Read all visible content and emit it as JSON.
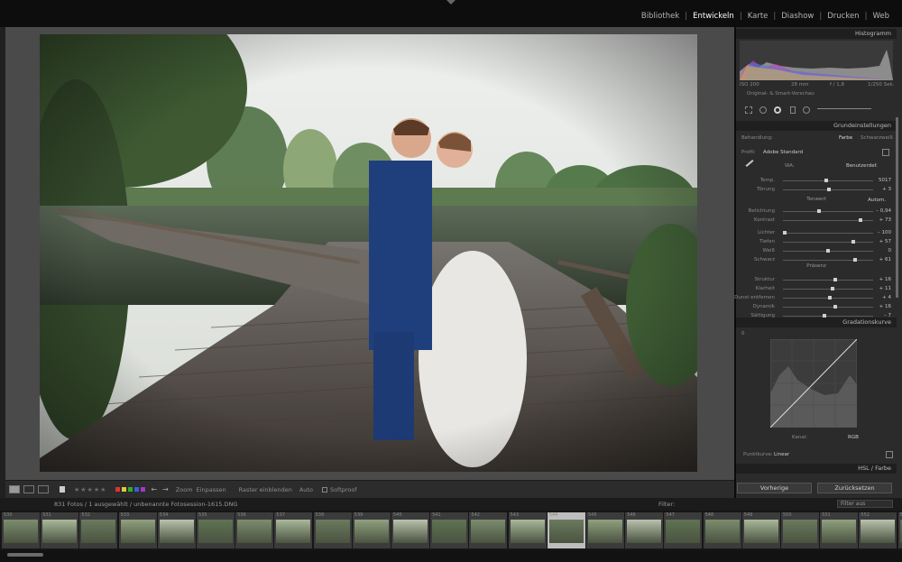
{
  "modules": [
    "Bibliothek",
    "Entwickeln",
    "Karte",
    "Diashow",
    "Drucken",
    "Web"
  ],
  "active_module": "Entwickeln",
  "toolbar": {
    "zoom_label": "Zoom",
    "zoom_value": "Einpassen",
    "raster_label": "Raster einblenden",
    "raster_value": "Auto",
    "softproof": "Softproof"
  },
  "panel": {
    "histogram": {
      "title": "Histogramm",
      "iso": "ISO 200",
      "focal": "28 mm",
      "aperture": "f / 1,8",
      "shutter": "1/250 Sek.",
      "preview_label": "Original- & Smart-Vorschau"
    },
    "basic": {
      "title": "Grundeinstellungen",
      "treatment_label": "Behandlung:",
      "treatment_color": "Farbe",
      "treatment_bw": "Schwarzweiß",
      "profile_label": "Profil:",
      "profile_value": "Adobe Standard",
      "wb_label": "WA:",
      "wb_value": "Benutzerdef.",
      "sliders": [
        {
          "label": "Temp.",
          "value": "5017",
          "pos": 0.48
        },
        {
          "label": "Tönung",
          "value": "+ 3",
          "pos": 0.51
        },
        {
          "label": "Belichtung",
          "value": "– 0,94",
          "pos": 0.4
        },
        {
          "label": "Kontrast",
          "value": "+ 73",
          "pos": 0.86
        },
        {
          "label": "Lichter",
          "value": "– 100",
          "pos": 0.02
        },
        {
          "label": "Tiefen",
          "value": "+ 57",
          "pos": 0.78
        },
        {
          "label": "Weiß",
          "value": "0",
          "pos": 0.5
        },
        {
          "label": "Schwarz",
          "value": "+ 61",
          "pos": 0.8
        },
        {
          "label": "Struktur",
          "value": "+ 16",
          "pos": 0.58
        },
        {
          "label": "Klarheit",
          "value": "+ 11",
          "pos": 0.55
        },
        {
          "label": "Dunst entfernen",
          "value": "+ 4",
          "pos": 0.52
        },
        {
          "label": "Dynamik",
          "value": "+ 16",
          "pos": 0.58
        },
        {
          "label": "Sättigung",
          "value": "– 7",
          "pos": 0.46
        }
      ],
      "tone_label": "Tonwert",
      "tone_auto": "Autom.",
      "presence_label": "Präsenz"
    },
    "curve": {
      "title": "Gradationskurve",
      "zero": "0",
      "channel_label": "Kanal:",
      "channel_value": "RGB",
      "point_curve_label": "Punktkurve:",
      "point_curve_value": "Linear"
    },
    "hsl": {
      "title": "HSL / Farbe"
    },
    "prev_button": "Vorherige",
    "reset_button": "Zurücksetzen"
  },
  "filmstrip": {
    "info": "831 Fotos / 1 ausgewählt / unbenannte Fotosession-1615.DNG",
    "filter_label": "Filter:",
    "filter_value": "Filter aus",
    "frames": [
      "530",
      "531",
      "532",
      "533",
      "534",
      "535",
      "536",
      "537",
      "538",
      "539",
      "540",
      "541",
      "542",
      "543",
      "544",
      "545",
      "546",
      "547",
      "548",
      "549",
      "550",
      "551",
      "552",
      "553"
    ],
    "selected_index": 14
  },
  "colors": {
    "panel_bg": "#2b2b2b",
    "canvas_bg": "#4a4a4a",
    "header_bg": "#1f1f1f",
    "active_text": "#ffffff"
  }
}
